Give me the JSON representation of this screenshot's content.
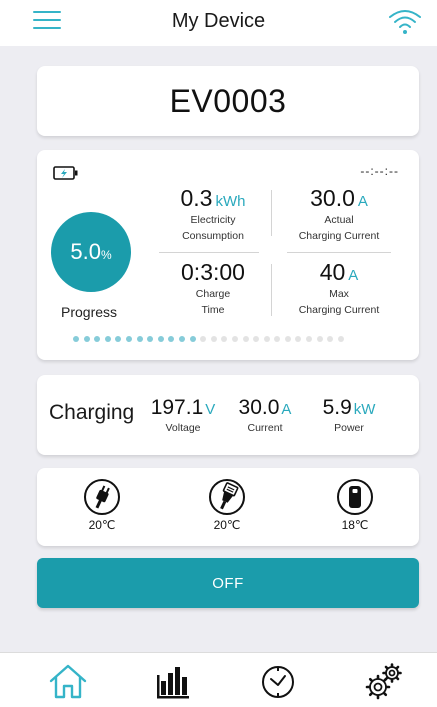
{
  "header": {
    "title": "My Device",
    "menu_icon": "hamburger-menu-icon",
    "wifi_icon": "wifi-icon"
  },
  "device": {
    "id": "EV0003"
  },
  "status": {
    "battery_icon": "battery-charging-icon",
    "time": "--:--:--",
    "progress": {
      "value": "5.0",
      "unit": "%",
      "label": "Progress",
      "fraction": 0.05
    },
    "electricity": {
      "value": "0.3",
      "unit": "kWh",
      "label_line1": "Electricity",
      "label_line2": "Consumption"
    },
    "actual_current": {
      "value": "30.0",
      "unit": "A",
      "label_line1": "Actual",
      "label_line2": "Charging Current"
    },
    "charge_time": {
      "value": "0:3:00",
      "label_line1": "Charge",
      "label_line2": "Time"
    },
    "max_current": {
      "value": "40",
      "unit": "A",
      "label_line1": "Max",
      "label_line2": "Charging Current"
    },
    "page_dots": {
      "active": 12,
      "total": 26
    }
  },
  "charging": {
    "state": "Charging",
    "voltage": {
      "value": "197.1",
      "unit": "V",
      "label": "Voltage"
    },
    "current": {
      "value": "30.0",
      "unit": "A",
      "label": "Current"
    },
    "power": {
      "value": "5.9",
      "unit": "kW",
      "label": "Power"
    }
  },
  "ports": [
    {
      "icon": "plug-icon",
      "temp": "20℃"
    },
    {
      "icon": "connector-plug-icon",
      "temp": "20℃"
    },
    {
      "icon": "charger-unit-icon",
      "temp": "18℃"
    }
  ],
  "actions": {
    "off_label": "OFF"
  },
  "nav": [
    {
      "icon": "home-icon"
    },
    {
      "icon": "bar-chart-icon"
    },
    {
      "icon": "clock-icon"
    },
    {
      "icon": "settings-gears-icon"
    }
  ],
  "colors": {
    "accent": "#1b9cab",
    "accent_light": "#2aa9bd",
    "background": "#ededf2",
    "card": "#ffffff",
    "dot_active": "#86ccd9",
    "dot_inactive": "#e3e3e3"
  }
}
